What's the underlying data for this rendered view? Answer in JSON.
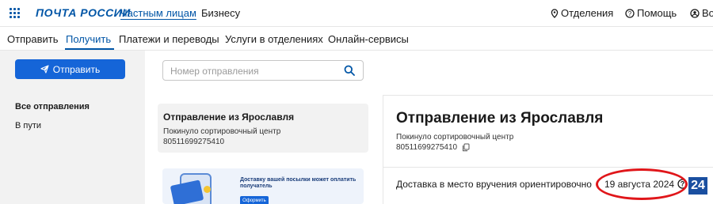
{
  "header": {
    "logo": "ПОЧТА РОССИИ",
    "nav_private": "Частным лицам",
    "nav_business": "Бизнесу",
    "offices": "Отделения",
    "help": "Помощь",
    "login": "Во"
  },
  "subnav": {
    "items": [
      "Отправить",
      "Получить",
      "Платежи и переводы",
      "Услуги в отделениях",
      "Онлайн-сервисы"
    ],
    "active": "Получить"
  },
  "sidebar": {
    "send_button": "Отправить",
    "items": [
      "Все отправления",
      "В пути"
    ]
  },
  "search": {
    "placeholder": "Номер отправления",
    "value": ""
  },
  "list": {
    "card_title": "Отправление из Ярославля",
    "card_status": "Покинуло сортировочный центр",
    "card_number": "80511699275410"
  },
  "promo": {
    "text": "Доставку вашей посылки может оплатить получатель",
    "button": "Оформить"
  },
  "detail": {
    "title": "Отправление из Ярославля",
    "status": "Покинуло сортировочный центр",
    "number": "80511699275410",
    "delivery_label": "Доставка в место вручения ориентировочно",
    "delivery_date": "19 августа 2024"
  },
  "overlay": {
    "badge": "24"
  },
  "colors": {
    "brand": "#0055a6",
    "button": "#1565d8",
    "highlight": "#e0161a"
  },
  "icons": [
    "grid-icon",
    "location-pin-icon",
    "help-icon",
    "user-icon",
    "send-plane-icon",
    "search-icon",
    "copy-icon",
    "question-circle-icon"
  ]
}
